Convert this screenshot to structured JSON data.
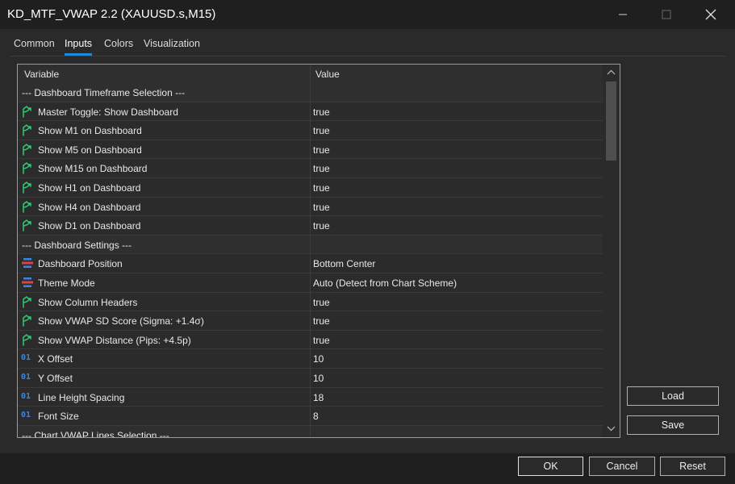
{
  "window": {
    "title": "KD_MTF_VWAP 2.2 (XAUUSD.s,M15)"
  },
  "tabs": [
    {
      "label": "Common",
      "active": false
    },
    {
      "label": "Inputs",
      "active": true
    },
    {
      "label": "Colors",
      "active": false
    },
    {
      "label": "Visualization",
      "active": false
    }
  ],
  "grid": {
    "headers": {
      "variable": "Variable",
      "value": "Value"
    },
    "rows": [
      {
        "type": "section",
        "variable": "--- Dashboard Timeframe Selection ---",
        "value": "",
        "icon": ""
      },
      {
        "type": "bool",
        "variable": "Master Toggle: Show Dashboard",
        "value": "true",
        "icon": "arrow-branch-icon"
      },
      {
        "type": "bool",
        "variable": "Show M1 on Dashboard",
        "value": "true",
        "icon": "arrow-branch-icon"
      },
      {
        "type": "bool",
        "variable": "Show M5 on Dashboard",
        "value": "true",
        "icon": "arrow-branch-icon"
      },
      {
        "type": "bool",
        "variable": "Show M15 on Dashboard",
        "value": "true",
        "icon": "arrow-branch-icon"
      },
      {
        "type": "bool",
        "variable": "Show H1 on Dashboard",
        "value": "true",
        "icon": "arrow-branch-icon"
      },
      {
        "type": "bool",
        "variable": "Show H4 on Dashboard",
        "value": "true",
        "icon": "arrow-branch-icon"
      },
      {
        "type": "bool",
        "variable": "Show D1 on Dashboard",
        "value": "true",
        "icon": "arrow-branch-icon"
      },
      {
        "type": "section",
        "variable": "--- Dashboard Settings ---",
        "value": "",
        "icon": ""
      },
      {
        "type": "enum",
        "variable": "Dashboard Position",
        "value": "Bottom Center",
        "icon": "enum-list-icon"
      },
      {
        "type": "enum",
        "variable": "Theme Mode",
        "value": "Auto (Detect from Chart Scheme)",
        "icon": "enum-list-icon"
      },
      {
        "type": "bool",
        "variable": "Show Column Headers",
        "value": "true",
        "icon": "arrow-branch-icon"
      },
      {
        "type": "bool",
        "variable": "Show VWAP SD Score (Sigma: +1.4σ)",
        "value": "true",
        "icon": "arrow-branch-icon"
      },
      {
        "type": "bool",
        "variable": "Show VWAP Distance (Pips: +4.5p)",
        "value": "true",
        "icon": "arrow-branch-icon"
      },
      {
        "type": "int",
        "variable": "X Offset",
        "value": "10",
        "icon": "integer-icon",
        "icon_text": "01"
      },
      {
        "type": "int",
        "variable": "Y Offset",
        "value": "10",
        "icon": "integer-icon",
        "icon_text": "01"
      },
      {
        "type": "int",
        "variable": "Line Height Spacing",
        "value": "18",
        "icon": "integer-icon",
        "icon_text": "01"
      },
      {
        "type": "int",
        "variable": "Font Size",
        "value": "8",
        "icon": "integer-icon",
        "icon_text": "01"
      },
      {
        "type": "section",
        "variable": "--- Chart VWAP Lines Selection ---",
        "value": "",
        "icon": ""
      }
    ]
  },
  "side_buttons": {
    "load": "Load",
    "save": "Save"
  },
  "footer_buttons": {
    "ok": "OK",
    "cancel": "Cancel",
    "reset": "Reset"
  },
  "colors": {
    "accent": "#1f8ad6",
    "bool_icon": "#2ecc71",
    "enum_icon_top": "#3a86e8",
    "enum_icon_mid": "#e04040",
    "int_icon": "#3a86e8"
  }
}
